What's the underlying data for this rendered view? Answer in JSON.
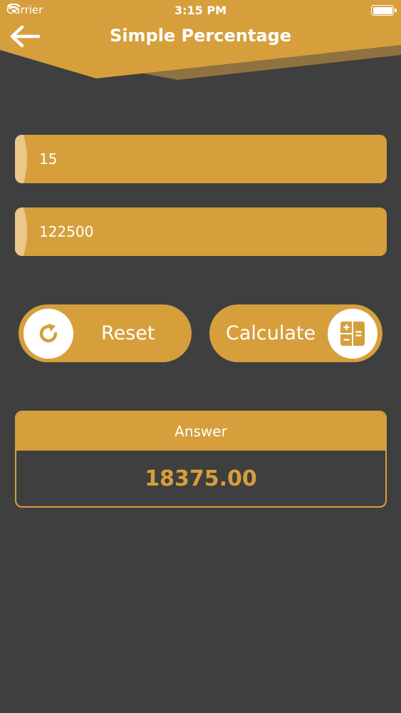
{
  "status_bar": {
    "carrier": "Carrier",
    "time": "3:15 PM"
  },
  "header": {
    "title": "Simple Percentage"
  },
  "inputs": {
    "percent_value": "15",
    "amount_value": "122500"
  },
  "buttons": {
    "reset_label": "Reset",
    "calculate_label": "Calculate"
  },
  "answer": {
    "heading": "Answer",
    "value": "18375.00"
  },
  "colors": {
    "accent": "#d69f3c",
    "background": "#3f3f40",
    "header_shadow": "#8f7240"
  }
}
